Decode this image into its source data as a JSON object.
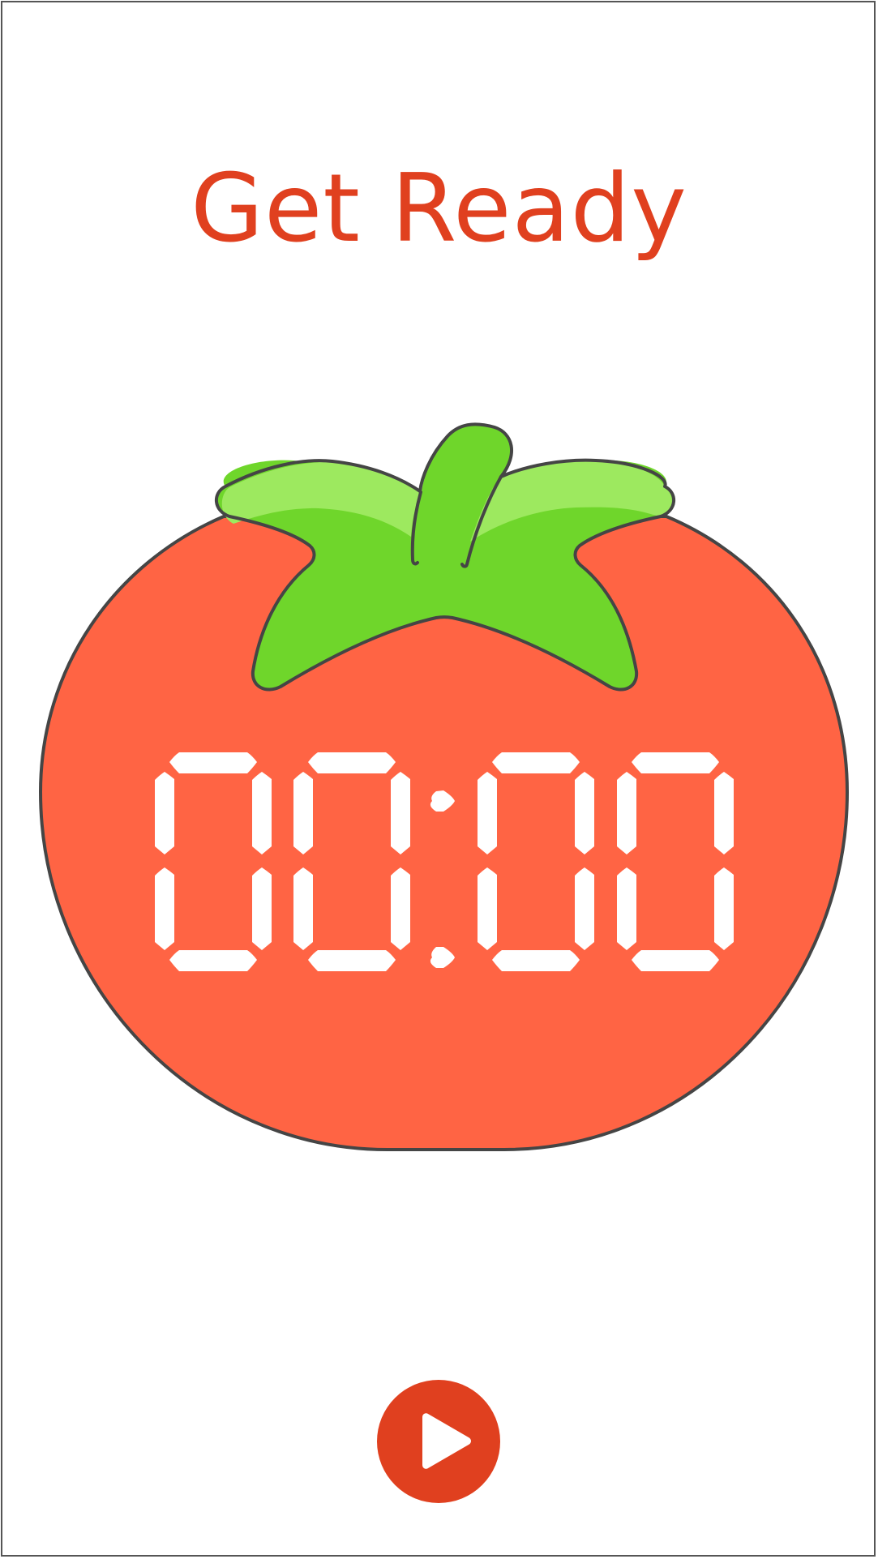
{
  "screen": {
    "title": "Get Ready",
    "title_color": "#E0401F"
  },
  "timer": {
    "display": "00:00",
    "minutes": "00",
    "seconds": "00",
    "digit_color": "#FFFFFF"
  },
  "tomato": {
    "body_color": "#FF6444",
    "leaf_color": "#6FD62B",
    "leaf_highlight_color": "#9DE95F",
    "outline_color": "#454545"
  },
  "controls": {
    "play_button": {
      "icon": "play-icon",
      "color": "#E0401F"
    }
  }
}
